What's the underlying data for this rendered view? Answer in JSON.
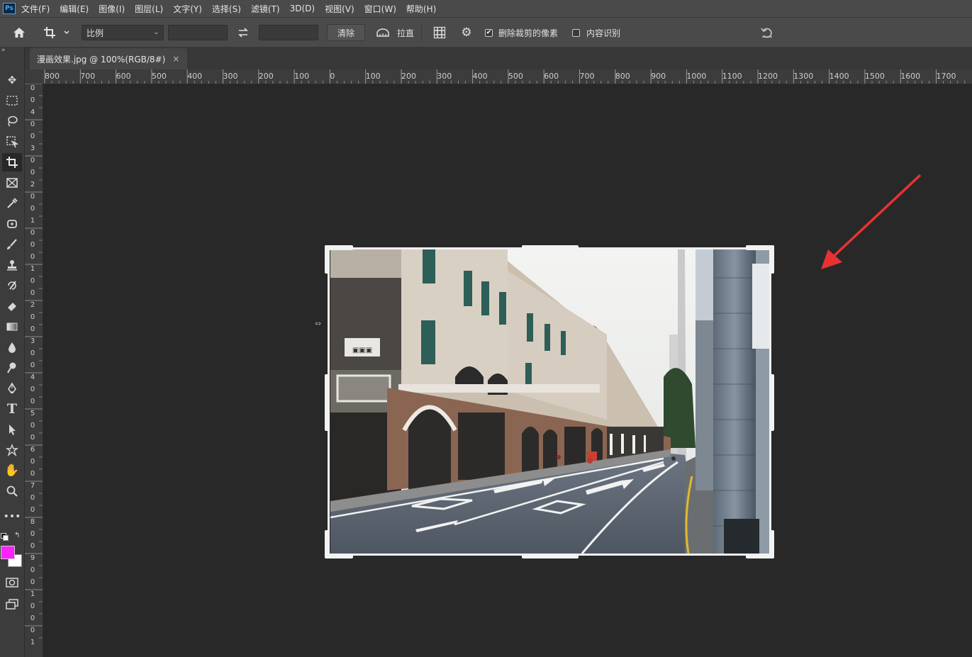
{
  "menubar": {
    "app_logo": "Ps",
    "items": [
      "文件(F)",
      "编辑(E)",
      "图像(I)",
      "图层(L)",
      "文字(Y)",
      "选择(S)",
      "滤镜(T)",
      "3D(D)",
      "视图(V)",
      "窗口(W)",
      "帮助(H)"
    ]
  },
  "options": {
    "ratio_select": "比例",
    "clear_label": "清除",
    "straighten_label": "拉直",
    "delete_cropped_label": "删除裁剪的像素",
    "content_aware_label": "内容识别",
    "delete_cropped_checked": true,
    "content_aware_checked": false
  },
  "document": {
    "tab_title": "漫画效果.jpg @ 100%(RGB/8#)",
    "close_symbol": "×"
  },
  "ruler": {
    "top_labels": [
      "800",
      "700",
      "600",
      "500",
      "400",
      "300",
      "200",
      "100",
      "0",
      "100",
      "200",
      "300",
      "400",
      "500",
      "600",
      "700",
      "800",
      "900",
      "1000",
      "1100",
      "1200",
      "1300",
      "1400",
      "1500",
      "1600",
      "1700"
    ],
    "left_labels": [
      "0",
      "0",
      "4",
      "0",
      "0",
      "3",
      "0",
      "0",
      "2",
      "0",
      "0",
      "1",
      "0",
      "0",
      "0",
      "1",
      "0",
      "0",
      "2",
      "0",
      "0",
      "3",
      "0",
      "0",
      "4",
      "0",
      "0",
      "5",
      "0",
      "0",
      "6",
      "0",
      "0",
      "7",
      "0",
      "0",
      "8",
      "0",
      "0",
      "9",
      "0",
      "0",
      "1",
      "0",
      "0",
      "0",
      "1"
    ]
  },
  "colors": {
    "foreground": "#ff22ff",
    "background": "#ffffff",
    "arrow": "#e83232"
  },
  "tools": [
    "move-icon",
    "marquee-icon",
    "lasso-icon",
    "object-select-icon",
    "crop-icon",
    "frame-icon",
    "eyedropper-icon",
    "healing-icon",
    "brush-icon",
    "stamp-icon",
    "history-brush-icon",
    "eraser-icon",
    "gradient-icon",
    "blur-icon",
    "dodge-icon",
    "pen-icon",
    "type-icon",
    "path-select-icon",
    "shape-icon",
    "hand-icon",
    "zoom-icon",
    "more-icon"
  ]
}
